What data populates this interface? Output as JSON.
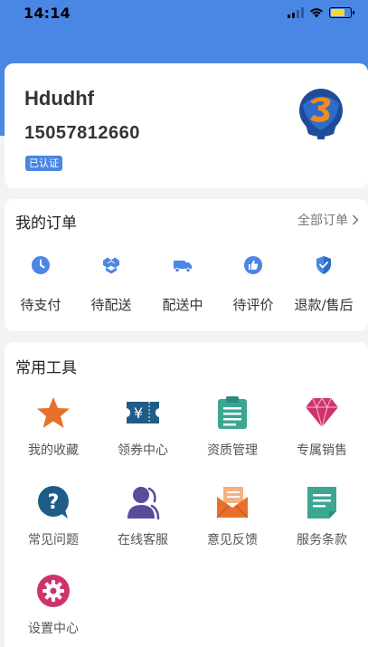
{
  "status_bar": {
    "time": "14:14"
  },
  "profile": {
    "name": "Hdudhf",
    "phone": "15057812660",
    "badge": "已认证"
  },
  "orders": {
    "title": "我的订单",
    "view_all": "全部订单",
    "items": [
      {
        "label": "待支付",
        "icon": "clock-icon"
      },
      {
        "label": "待配送",
        "icon": "box-icon"
      },
      {
        "label": "配送中",
        "icon": "truck-icon"
      },
      {
        "label": "待评价",
        "icon": "thumbs-up-icon"
      },
      {
        "label": "退款/售后",
        "icon": "shield-icon"
      }
    ]
  },
  "tools": {
    "title": "常用工具",
    "items": [
      {
        "label": "我的收藏",
        "icon": "star-icon"
      },
      {
        "label": "领券中心",
        "icon": "coupon-icon"
      },
      {
        "label": "资质管理",
        "icon": "clipboard-icon"
      },
      {
        "label": "专属销售",
        "icon": "diamond-icon"
      },
      {
        "label": "常见问题",
        "icon": "question-icon"
      },
      {
        "label": "在线客服",
        "icon": "customer-service-icon"
      },
      {
        "label": "意见反馈",
        "icon": "envelope-icon"
      },
      {
        "label": "服务条款",
        "icon": "document-icon"
      },
      {
        "label": "设置中心",
        "icon": "gear-icon"
      }
    ]
  },
  "colors": {
    "header": "#4a86e3",
    "order_icon": "#4a86e3",
    "star": "#e8702a",
    "coupon": "#1f5c87",
    "clipboard": "#3aa693",
    "diamond": "#d0326d",
    "question": "#1f5c87",
    "service": "#5b4b9a",
    "envelope": "#e8702a",
    "document": "#3aa693",
    "gear": "#d0326d"
  }
}
